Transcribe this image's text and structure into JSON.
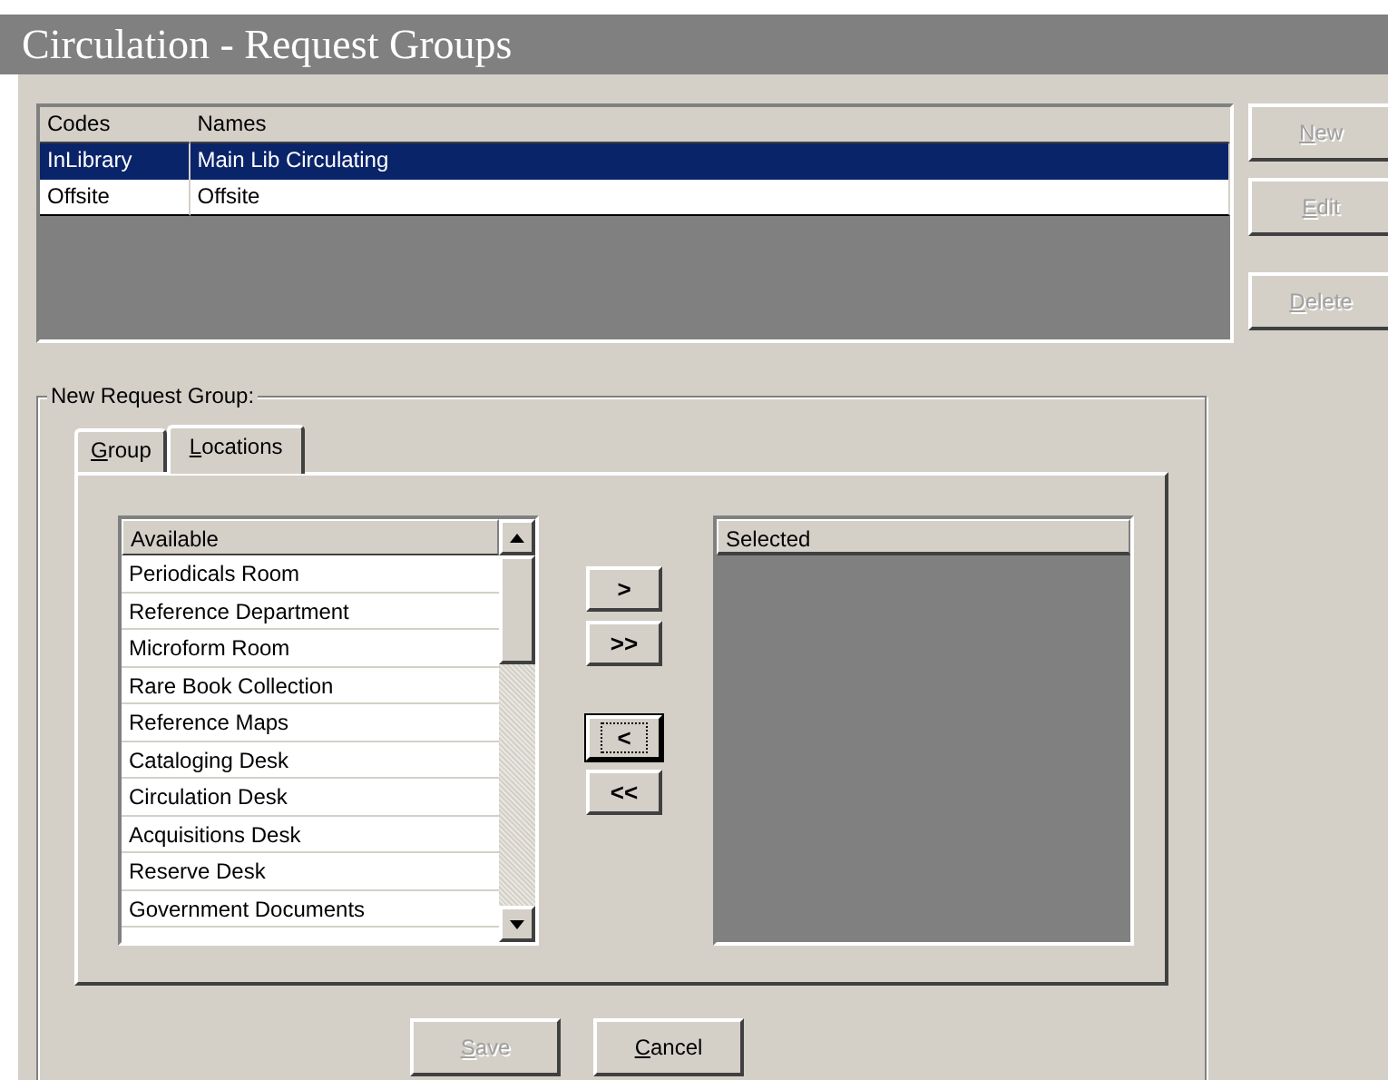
{
  "window": {
    "title": "Circulation - Request Groups"
  },
  "groups_table": {
    "columns": [
      "Codes",
      "Names"
    ],
    "rows": [
      {
        "cells": [
          "InLibrary",
          "Main Lib Circulating"
        ],
        "selected": true
      },
      {
        "cells": [
          "Offsite",
          "Offsite"
        ],
        "selected": false
      }
    ]
  },
  "side_buttons": [
    {
      "label": "New",
      "disabled": true
    },
    {
      "label": "Edit",
      "disabled": true
    },
    {
      "label": "Delete",
      "disabled": true
    }
  ],
  "form": {
    "legend": "New Request Group:",
    "tabs": [
      {
        "label": "Group",
        "selected": false
      },
      {
        "label": "Locations",
        "selected": true
      }
    ],
    "available": {
      "header": "Available",
      "items": [
        "Periodicals Room",
        "Reference Department",
        "Microform Room",
        "Rare Book Collection",
        "Reference Maps",
        "Cataloging Desk",
        "Circulation Desk",
        "Acquisitions Desk",
        "Reserve Desk",
        "Government Documents"
      ]
    },
    "move_buttons": [
      {
        "label": ">",
        "focused": false
      },
      {
        "label": ">>",
        "focused": false
      },
      {
        "label": "<",
        "focused": true
      },
      {
        "label": "<<",
        "focused": false
      }
    ],
    "selected_list": {
      "header": "Selected"
    },
    "buttons": [
      {
        "label": "Save",
        "disabled": true
      },
      {
        "label": "Cancel",
        "disabled": false
      }
    ]
  }
}
